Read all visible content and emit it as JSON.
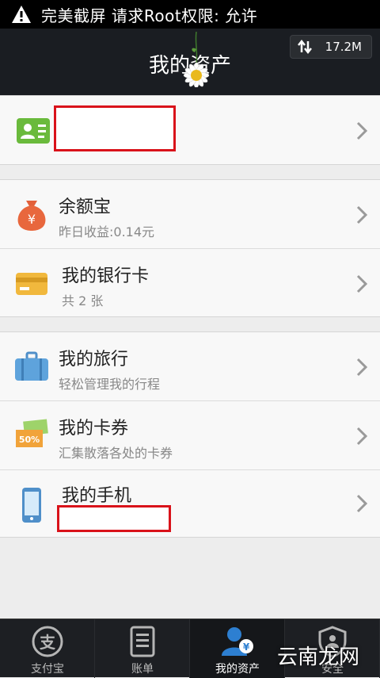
{
  "status_bar": {
    "text": "完美截屏 请求Root权限: 允许"
  },
  "header": {
    "title": "我的资产",
    "speed_indicator": "17.2M"
  },
  "account": {},
  "section_finance": [
    {
      "title": "余额宝",
      "subtitle": "昨日收益:0.14元"
    },
    {
      "title": "我的银行卡",
      "subtitle": "共 2 张"
    }
  ],
  "section_life": [
    {
      "title": "我的旅行",
      "subtitle": "轻松管理我的行程"
    },
    {
      "title": "我的卡券",
      "subtitle": "汇集散落各处的卡券"
    },
    {
      "title": "我的手机",
      "subtitle": ""
    }
  ],
  "coupon_badge": "50%",
  "tabbar": [
    {
      "label": "支付宝",
      "icon": "alipay-icon"
    },
    {
      "label": "账单",
      "icon": "bill-icon"
    },
    {
      "label": "我的资产",
      "icon": "assets-icon"
    },
    {
      "label": "安全",
      "icon": "security-icon"
    }
  ],
  "watermark": "云南龙网",
  "colors": {
    "header_bg": "#1a1d22",
    "redact": "#d9121a",
    "tab_active": "#2d7fd1"
  }
}
